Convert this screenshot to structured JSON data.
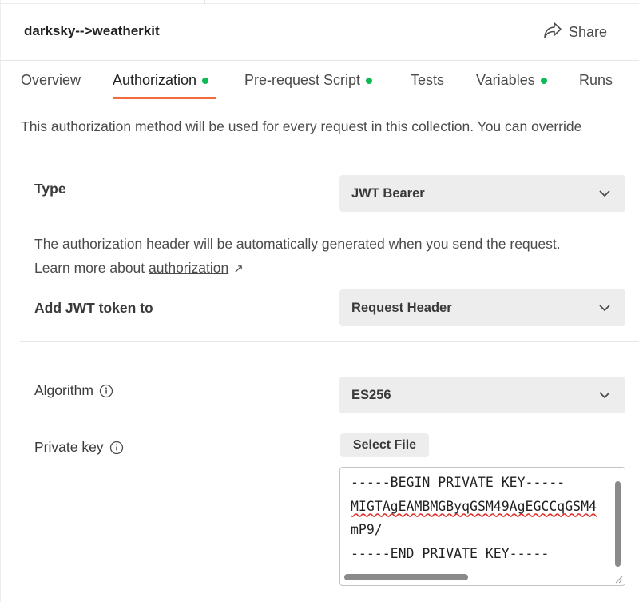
{
  "header": {
    "title": "darksky-->weatherkit",
    "share_label": "Share",
    "share_icon": "share-arrow-icon"
  },
  "tabs": [
    {
      "label": "Overview",
      "dot": false,
      "active": false
    },
    {
      "label": "Authorization",
      "dot": true,
      "active": true
    },
    {
      "label": "Pre-request Script",
      "dot": true,
      "active": false
    },
    {
      "label": "Tests",
      "dot": false,
      "active": false
    },
    {
      "label": "Variables",
      "dot": true,
      "active": false
    },
    {
      "label": "Runs",
      "dot": false,
      "active": false
    }
  ],
  "description": "This authorization method will be used for every request in this collection. You can override",
  "auth": {
    "type_label": "Type",
    "type_value": "JWT Bearer",
    "help_text_before": "The authorization header will be automatically generated when you send the request. Learn more about ",
    "help_link": "authorization",
    "help_link_arrow": "↗",
    "add_token_label": "Add JWT token to",
    "add_token_value": "Request Header",
    "algorithm_label": "Algorithm",
    "algorithm_value": "ES256",
    "private_key_label": "Private key",
    "select_file_label": "Select File",
    "private_key_lines": [
      "-----BEGIN PRIVATE KEY-----",
      "MIGTAgEAMBMGByqGSM49AgEGCCqGSM4",
      "mP9/",
      "-----END PRIVATE KEY-----"
    ]
  },
  "colors": {
    "accent_underline": "#f26b3a",
    "status_dot": "#0cbb52",
    "spellcheck": "#e0312b"
  }
}
